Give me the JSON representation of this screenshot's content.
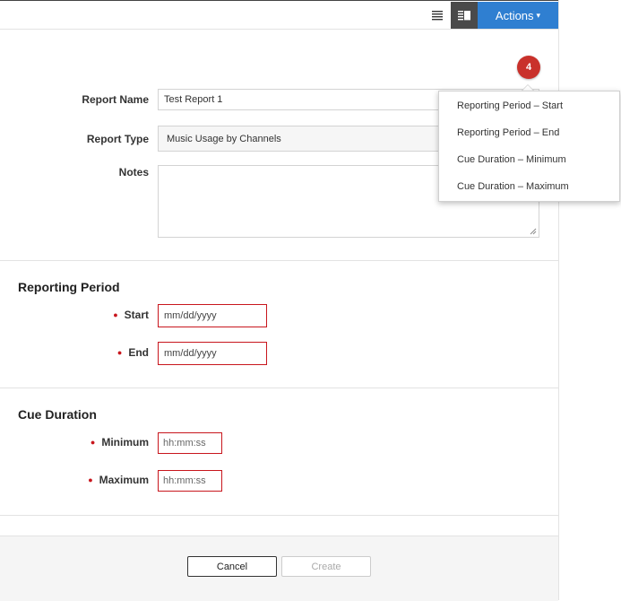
{
  "toolbar": {
    "list_view_icon": "list-view-icon",
    "split_view_icon": "split-view-icon",
    "actions_label": "Actions",
    "actions_caret": "▾"
  },
  "form": {
    "report_name": {
      "label": "Report Name",
      "value": "Test Report 1"
    },
    "report_type": {
      "label": "Report Type",
      "value": "Music Usage by Channels"
    },
    "notes": {
      "label": "Notes",
      "value": ""
    }
  },
  "reporting_period": {
    "title": "Reporting Period",
    "start": {
      "label": "Start",
      "placeholder": "mm/dd/yyyy"
    },
    "end": {
      "label": "End",
      "placeholder": "mm/dd/yyyy"
    }
  },
  "cue_duration": {
    "title": "Cue Duration",
    "minimum": {
      "label": "Minimum",
      "placeholder": "hh:mm:ss"
    },
    "maximum": {
      "label": "Maximum",
      "placeholder": "hh:mm:ss"
    }
  },
  "validation": {
    "error_count": "4",
    "required_marker": "●",
    "items": [
      "Reporting Period – Start",
      "Reporting Period – End",
      "Cue Duration – Minimum",
      "Cue Duration – Maximum"
    ]
  },
  "footer": {
    "cancel_label": "Cancel",
    "create_label": "Create"
  },
  "colors": {
    "accent": "#2f7fd1",
    "error": "#c8161d",
    "badge": "#c9312b"
  }
}
